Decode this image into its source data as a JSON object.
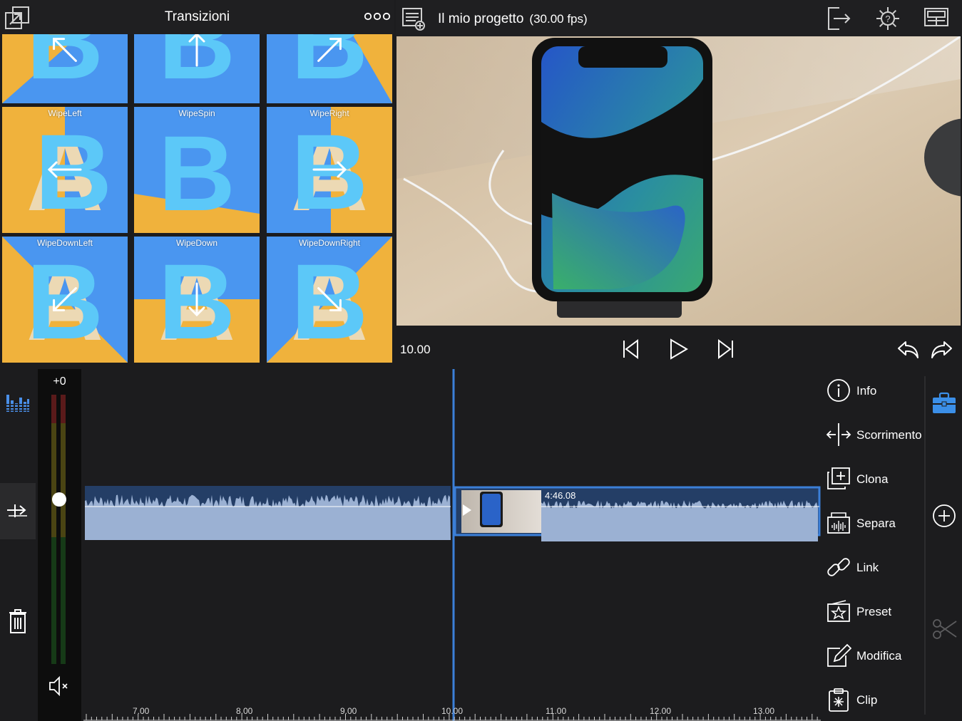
{
  "transitions_panel": {
    "title": "Transizioni",
    "tiles": [
      {
        "label": ""
      },
      {
        "label": ""
      },
      {
        "label": ""
      },
      {
        "label": "WipeLeft"
      },
      {
        "label": "WipeSpin"
      },
      {
        "label": "WipeRight"
      },
      {
        "label": "WipeDownLeft"
      },
      {
        "label": "WipeDown"
      },
      {
        "label": "WipeDownRight"
      }
    ]
  },
  "project": {
    "title": "Il mio progetto",
    "fps": "(30.00 fps)"
  },
  "transport": {
    "timecode": "10.00"
  },
  "audio_meter": {
    "gain": "+0",
    "level": 0.61
  },
  "timeline": {
    "clip_duration": "4:46.08",
    "ruler_labels": [
      "7.00",
      "8.00",
      "9.00",
      "10.00",
      "11.00",
      "12.00",
      "13.00"
    ]
  },
  "tools": [
    {
      "label": "Info",
      "icon": "info-icon"
    },
    {
      "label": "Scorrimento",
      "icon": "slide-icon"
    },
    {
      "label": "Clona",
      "icon": "clone-icon"
    },
    {
      "label": "Separa",
      "icon": "split-icon"
    },
    {
      "label": "Link",
      "icon": "link-icon"
    },
    {
      "label": "Preset",
      "icon": "preset-star-icon"
    },
    {
      "label": "Modifica",
      "icon": "edit-pencil-icon"
    },
    {
      "label": "Clip",
      "icon": "clipboard-icon"
    }
  ],
  "colors": {
    "accent": "#3b7fd8",
    "tile_blue": "#4a96f0",
    "tile_orange": "#f0b23c",
    "clip_fill": "#243e66",
    "wave": "#9bb1d3"
  }
}
